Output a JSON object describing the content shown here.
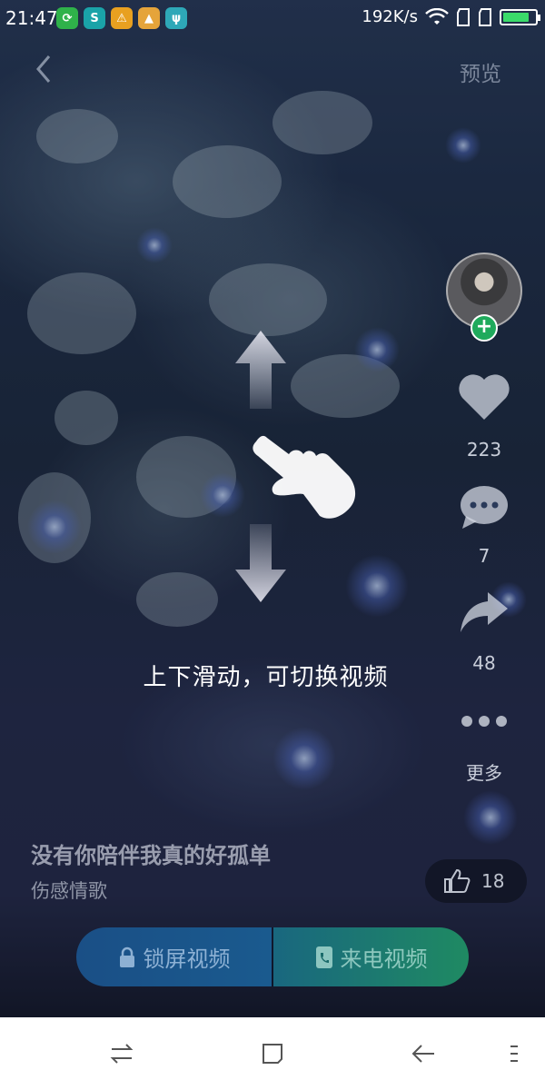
{
  "status_bar": {
    "time": "21:47",
    "network_speed": "192K/s",
    "notification_icons": [
      "refresh-icon",
      "browser-icon",
      "warning-icon",
      "gallery-icon",
      "usb-icon"
    ],
    "battery_level": 0.85
  },
  "header": {
    "back_icon": "chevron-left-icon",
    "preview_label": "预览"
  },
  "actions": {
    "likes": "223",
    "comments": "7",
    "shares": "48",
    "more_label": "更多"
  },
  "gesture_hint": {
    "text": "上下滑动，可切换视频"
  },
  "video": {
    "title": "没有你陪伴我真的好孤单",
    "category": "伤感情歌",
    "thumbs_up_count": "18"
  },
  "buttons": {
    "lock_screen_label": "锁屏视频",
    "caller_label": "来电视频"
  },
  "nav_bar": {
    "icons": [
      "switch-icon",
      "home-icon",
      "back-icon",
      "menu-icon"
    ]
  },
  "colors": {
    "accent_green": "#1faa5c",
    "lock_button_blue": "#1a4f86",
    "call_button_green": "#1f8a62"
  }
}
